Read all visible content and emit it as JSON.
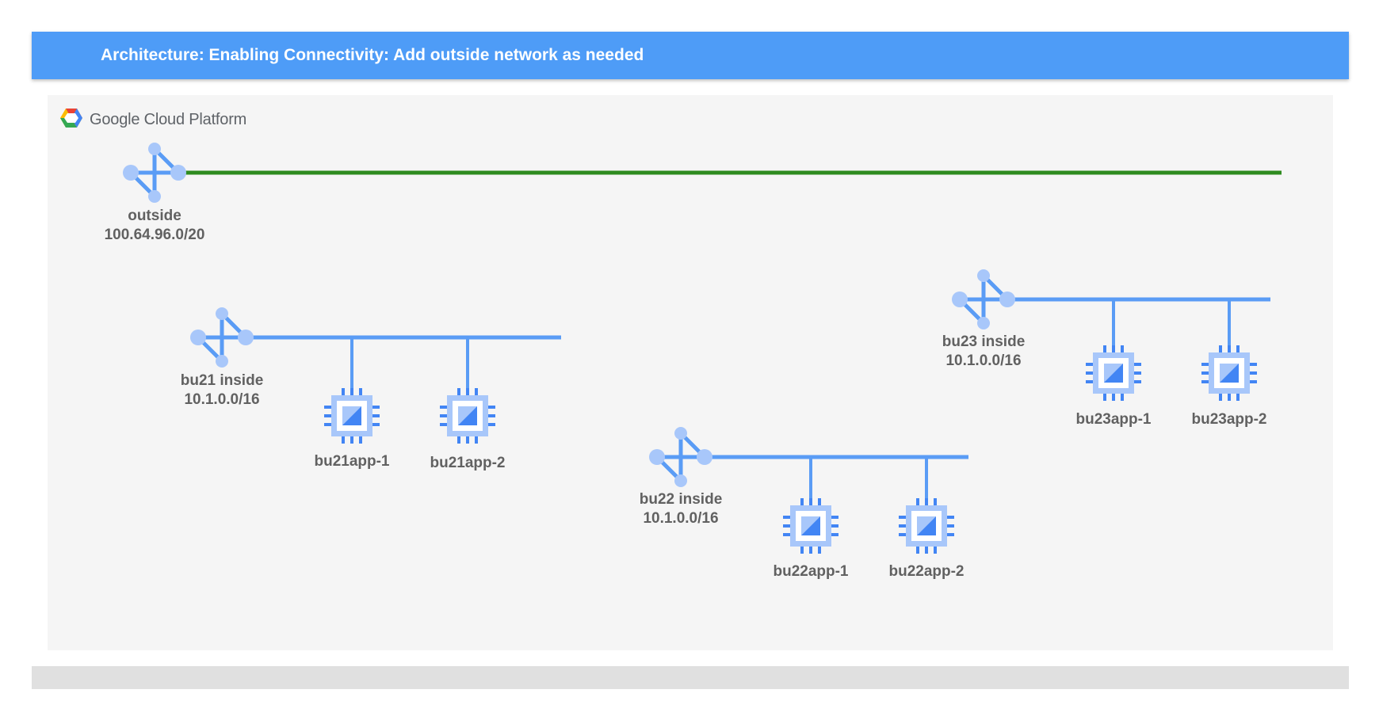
{
  "header": {
    "title": "Architecture: Enabling Connectivity: Add outside network as needed"
  },
  "brand": {
    "name": "Google Cloud Platform",
    "logo_icon": "google-cloud-hexagon-icon"
  },
  "colors": {
    "banner": "#4e9cf7",
    "network_line": "#5a9cf5",
    "outside_line": "#2e8b1f",
    "icon_light": "#a8c7fa",
    "icon_dark": "#4285f4",
    "label": "#616161"
  },
  "networks": {
    "outside": {
      "name": "outside",
      "cidr": "100.64.96.0/20"
    },
    "bu21": {
      "name": "bu21 inside",
      "cidr": "10.1.0.0/16",
      "apps": [
        "bu21app-1",
        "bu21app-2"
      ]
    },
    "bu22": {
      "name": "bu22 inside",
      "cidr": "10.1.0.0/16",
      "apps": [
        "bu22app-1",
        "bu22app-2"
      ]
    },
    "bu23": {
      "name": "bu23 inside",
      "cidr": "10.1.0.0/16",
      "apps": [
        "bu23app-1",
        "bu23app-2"
      ]
    }
  }
}
